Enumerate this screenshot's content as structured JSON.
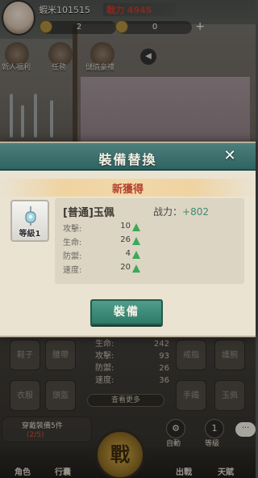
{
  "player": {
    "name": "蝦米101515",
    "power_label": "戰力 4945",
    "resource1": "2",
    "resource2": "0"
  },
  "scene_menu": [
    {
      "label": "新人福利",
      "icon": "gift-icon"
    },
    {
      "label": "任務",
      "icon": "scroll-icon"
    },
    {
      "label": "儲值豪禮",
      "icon": "treasure-icon"
    }
  ],
  "modal": {
    "title": "裝備替換",
    "close_label": "✕",
    "banner": "新獲得",
    "item": {
      "level": "等級1",
      "name": "[普通]玉佩",
      "power_caption": "战力：",
      "power_value": "+802",
      "stats": [
        {
          "key": "攻擊:",
          "value": "10"
        },
        {
          "key": "生命:",
          "value": "26"
        },
        {
          "key": "防禦:",
          "value": "4"
        },
        {
          "key": "速度:",
          "value": "20"
        }
      ]
    },
    "equip_button": "裝備"
  },
  "background_panel": {
    "slots_left": [
      "鞋子",
      "腰帶",
      "衣服",
      "頭盔"
    ],
    "slots_right": [
      "戒指",
      "護腕",
      "手鐲",
      "玉佩"
    ],
    "stats": [
      {
        "key": "生命:",
        "value": "242"
      },
      {
        "key": "攻擊:",
        "value": "93"
      },
      {
        "key": "防禦:",
        "value": "26"
      },
      {
        "key": "速度:",
        "value": "36"
      }
    ],
    "more_button": "查看更多",
    "quest_text": "穿戴裝備5件",
    "quest_count": "(2/5)",
    "auto_label": "自動",
    "level_label": "等級",
    "level_badge": "1",
    "chat_icon": "···"
  },
  "bottom_nav": {
    "left1": "角色",
    "left2": "行囊",
    "center": "戰",
    "right1": "出戰",
    "right2": "天賦"
  },
  "colors": {
    "header": "#2f6462",
    "accent_green": "#3f8a73",
    "banner_text": "#b5402f"
  }
}
